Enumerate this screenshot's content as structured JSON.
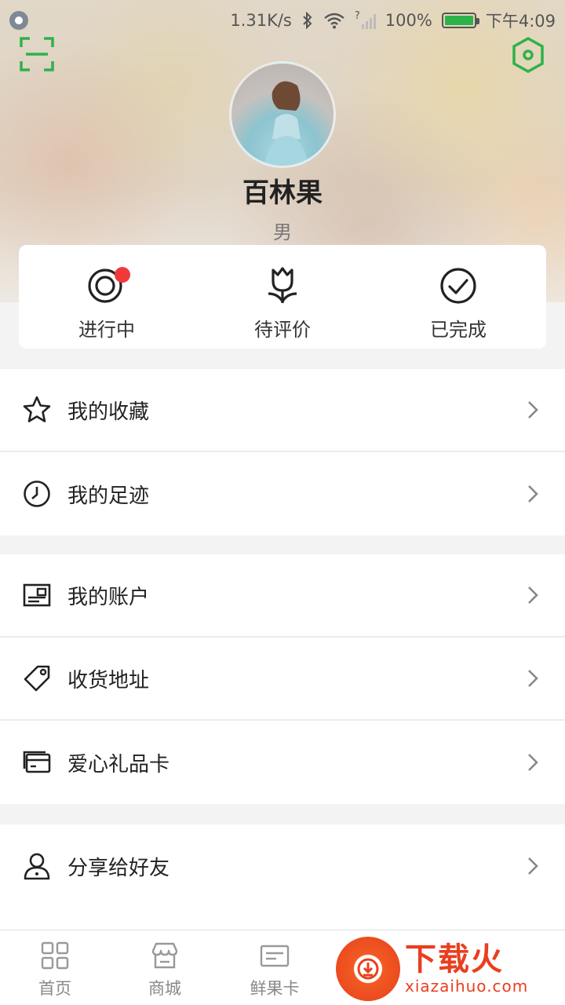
{
  "status_bar": {
    "speed": "1.31K/s",
    "signal_mark": "?",
    "battery": "100%",
    "battery_level": 1.0,
    "time": "下午4:09"
  },
  "profile": {
    "name": "百林果",
    "gender": "男"
  },
  "orders": [
    {
      "label": "进行中",
      "icon": "in-progress-icon",
      "has_badge": true
    },
    {
      "label": "待评价",
      "icon": "tulip-icon",
      "has_badge": false
    },
    {
      "label": "已完成",
      "icon": "check-circle-icon",
      "has_badge": false
    }
  ],
  "menu": {
    "group1": [
      {
        "label": "我的收藏",
        "icon": "star-icon"
      },
      {
        "label": "我的足迹",
        "icon": "clock-icon"
      }
    ],
    "group2": [
      {
        "label": "我的账户",
        "icon": "id-card-icon"
      },
      {
        "label": "收货地址",
        "icon": "tag-icon"
      },
      {
        "label": "爱心礼品卡",
        "icon": "card-icon"
      }
    ],
    "group3": [
      {
        "label": "分享给好友",
        "icon": "person-icon"
      }
    ]
  },
  "tabs": [
    {
      "label": "首页",
      "icon": "grid-icon"
    },
    {
      "label": "商城",
      "icon": "store-icon"
    },
    {
      "label": "鲜果卡",
      "icon": "card-outline-icon"
    }
  ],
  "watermark": {
    "name": "下载火",
    "domain": "xiazaihuo.com"
  },
  "colors": {
    "accent": "#2db24a",
    "badge": "#f03a3a",
    "watermark": "#ea3e1f"
  }
}
